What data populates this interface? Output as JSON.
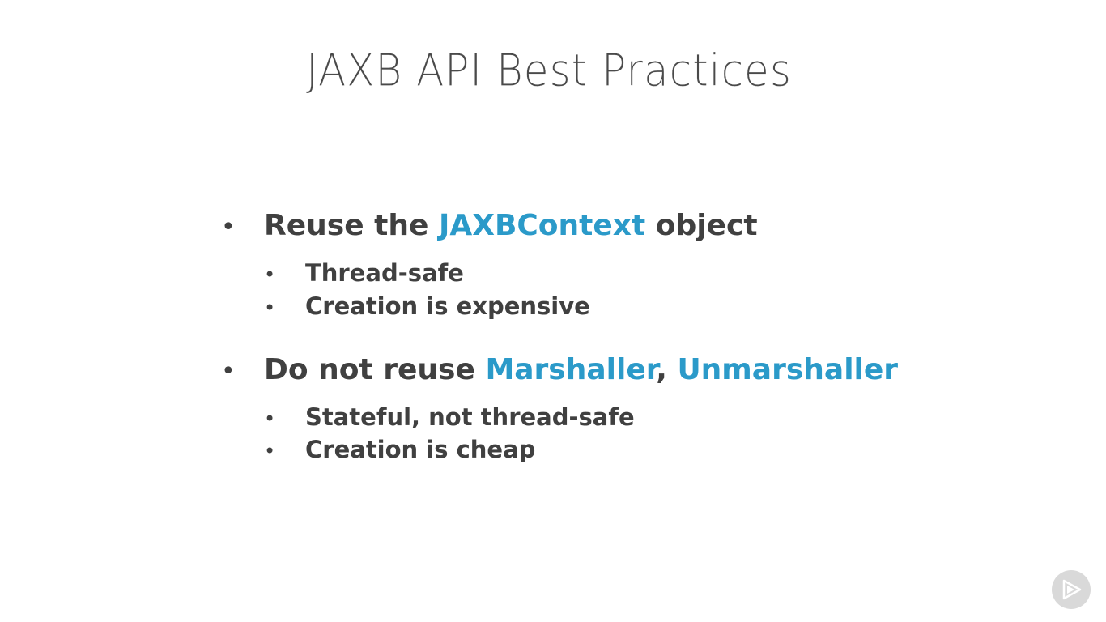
{
  "slide": {
    "title": "JAXB API Best Practices",
    "accent_color": "#2b9ac9",
    "text_color": "#404040",
    "bullets": [
      {
        "prefix": "Reuse the ",
        "highlight": "JAXBContext",
        "suffix": " object",
        "sub": [
          "Thread-safe",
          "Creation is expensive"
        ]
      },
      {
        "prefix": "Do not reuse ",
        "highlight": "Marshaller",
        "separator": ", ",
        "highlight2": "Unmarshaller",
        "sub": [
          "Stateful, not thread-safe",
          "Creation is cheap"
        ]
      }
    ]
  },
  "player": {
    "play_icon": "play-icon"
  }
}
